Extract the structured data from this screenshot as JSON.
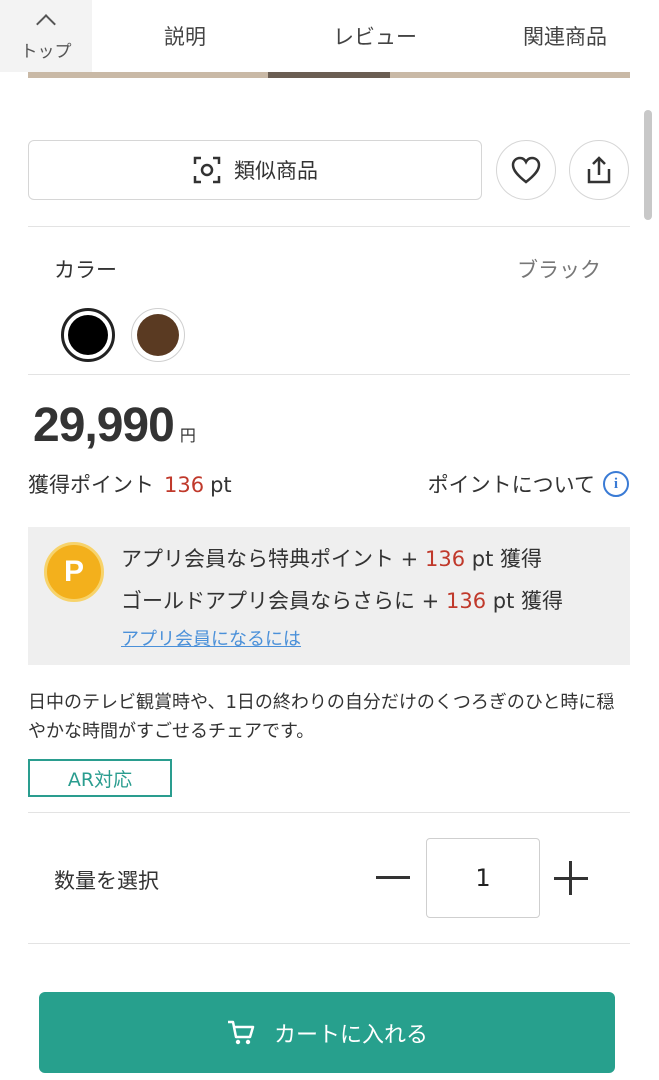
{
  "tabs": {
    "top_label": "トップ",
    "items": [
      {
        "label": "説明"
      },
      {
        "label": "レビュー"
      },
      {
        "label": "関連商品"
      }
    ]
  },
  "actions": {
    "similar_label": "類似商品",
    "icons": [
      "camera-scan-icon",
      "heart-icon",
      "share-icon"
    ]
  },
  "color": {
    "label": "カラー",
    "selected": "ブラック",
    "swatches": [
      "#000000",
      "#5a3a22"
    ]
  },
  "price": {
    "amount": "29,990",
    "currency": "円"
  },
  "points": {
    "label": "獲得ポイント",
    "value": "136",
    "unit": "pt",
    "about_label": "ポイントについて"
  },
  "app_promo": {
    "badge": "P",
    "line1_prefix": "アプリ会員なら特典ポイント +",
    "line1_value": "136",
    "line1_suffix": "pt 獲得",
    "line2_prefix": "ゴールドアプリ会員ならさらに +",
    "line2_value": "136",
    "line2_suffix": "pt 獲得",
    "link": "アプリ会員になるには"
  },
  "description": "日中のテレビ観賞時や、1日の終わりの自分だけのくつろぎのひと時に穏やかな時間がすごせるチェアです。",
  "ar_badge": "AR対応",
  "quantity": {
    "label": "数量を選択",
    "value": "1"
  },
  "cart": {
    "label": "カートに入れる"
  },
  "colors": {
    "accent": "#27a08d",
    "point_red": "#c0392b",
    "link_blue": "#4a90d9",
    "badge_gold": "#f3b01c"
  }
}
